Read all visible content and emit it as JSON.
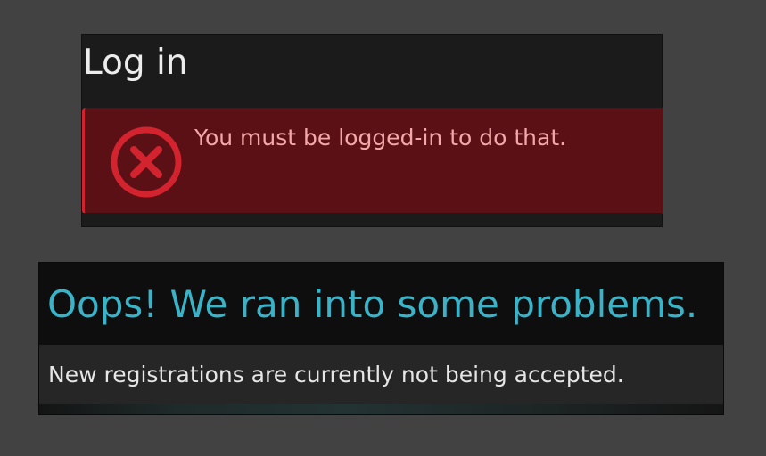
{
  "login": {
    "title": "Log in",
    "error": {
      "icon": "error-circle-x-icon",
      "message": "You must be logged-in to do that."
    }
  },
  "registration": {
    "title": "Oops! We ran into some problems.",
    "message": "New registrations are currently not being accepted."
  },
  "colors": {
    "background": "#424242",
    "panel": "#1b1b1b",
    "error_bg": "#5a1014",
    "error_accent": "#d2232f",
    "error_text": "#f3a7a9",
    "heading_accent": "#3ab3c8"
  }
}
